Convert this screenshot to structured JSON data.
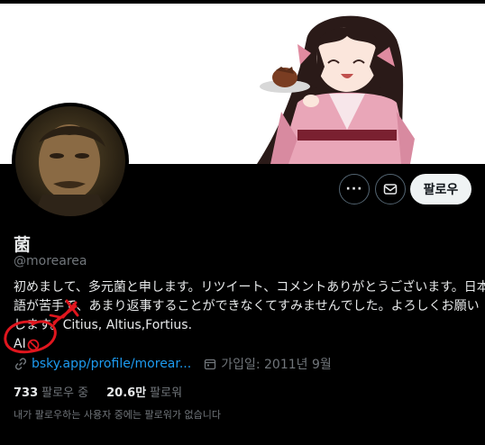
{
  "profile": {
    "name": "菌",
    "handle": "@morearea",
    "bio_lines": [
      "初めまして、多元菌と申します。リツイート、コメントありがとうございます。日本",
      "語が苦手で、あまり返事することができなくてすみませんでした。よろしくお願い",
      "します。Citius, Altius,Fortius."
    ],
    "bio_ai": "AI",
    "link": "bsky.app/profile/morear...",
    "joined": "가입일: 2011년 9월",
    "following_count": "733",
    "following_label": "팔로우 중",
    "followers_count": "20.6만",
    "followers_label": "팔로워",
    "followers_you_know": "내가 팔로우하는 사용자 중에는 팔로워가 없습니다"
  },
  "actions": {
    "more_icon": "more-icon",
    "message_icon": "mail-icon",
    "follow_label": "팔로우"
  },
  "colors": {
    "background": "#000000",
    "text": "#e7e9ea",
    "muted": "#71767b",
    "link": "#1d9bf0",
    "annotation": "#e0161e"
  }
}
